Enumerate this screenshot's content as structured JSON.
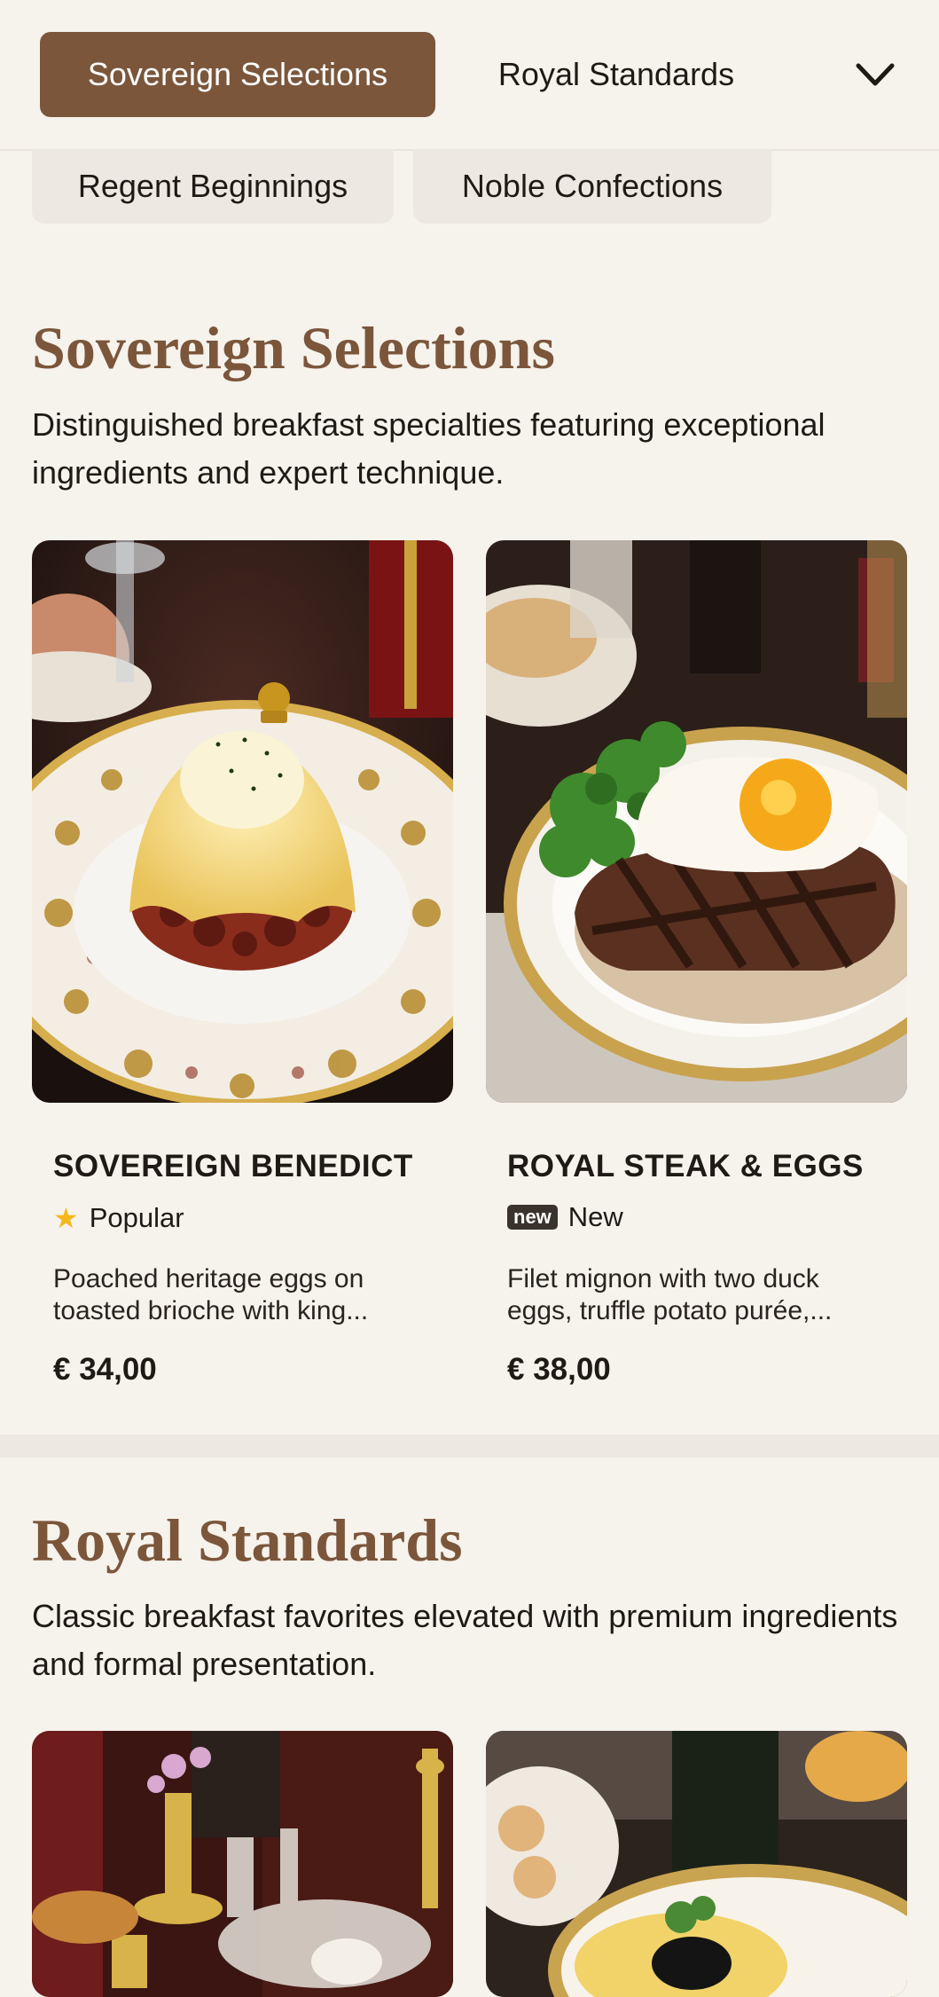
{
  "nav": {
    "active_tab": "Sovereign Selections",
    "tab_2": "Royal Standards",
    "more_icon": "chevron-down-icon",
    "pills": [
      "Regent Beginnings",
      "Noble Confections"
    ]
  },
  "sections": [
    {
      "title": "Sovereign Selections",
      "description": "Distinguished breakfast specialties featuring exceptional ingredients and expert technique.",
      "items": [
        {
          "name": "SOVEREIGN BENEDICT",
          "badge_icon": "star-icon",
          "badge": "Popular",
          "description": "Poached heritage eggs on toasted brioche with king...",
          "price": "€ 34,00"
        },
        {
          "name": "ROYAL STEAK & EGGS",
          "badge_tag": "new",
          "badge": "New",
          "description": "Filet mignon with two duck eggs, truffle potato purée,...",
          "price": "€ 38,00"
        }
      ]
    },
    {
      "title": "Royal Standards",
      "description": "Classic breakfast favorites elevated with premium ingredients and formal presentation."
    }
  ],
  "colors": {
    "accent": "#7b563b",
    "background": "#f6f2ec",
    "star": "#f2b81c"
  }
}
